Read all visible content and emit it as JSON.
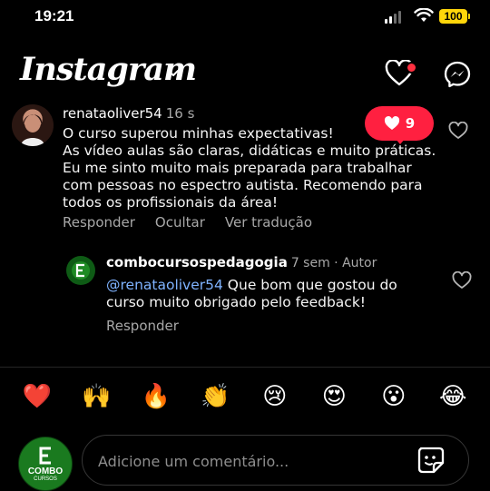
{
  "status_bar": {
    "time": "19:21",
    "battery": "100"
  },
  "header": {
    "title": "Instagram",
    "chevron_icon": "chevron-down-icon",
    "activity_icon": "heart-outline-icon",
    "messenger_icon": "messenger-icon"
  },
  "like_notification": {
    "count": "9",
    "icon": "heart-filled-icon",
    "color": "#ff2040"
  },
  "comment": {
    "username": "renataoliver54",
    "time": "16 s",
    "text": "O curso superou minhas expectativas!\nAs vídeo aulas são claras, didáticas e muito práticas. Eu me sinto muito mais preparada para trabalhar com pessoas no espectro autista. Recomendo para todos os profissionais da área!",
    "actions": [
      "Responder",
      "Ocultar",
      "Ver tradução"
    ]
  },
  "reply": {
    "username": "combocursospedagogia",
    "time": "7 sem",
    "author_tag": "Autor",
    "meta": "7 sem · Autor",
    "mention": "@renataoliver54",
    "text": " Que bom que gostou do curso muito obrigado pelo feedback!",
    "action": "Responder"
  },
  "emoji_reactions": [
    "❤️",
    "🙌",
    "🔥",
    "👏",
    "😢",
    "😍",
    "😮",
    "😂"
  ],
  "composer": {
    "placeholder": "Adicione um comentário...",
    "avatar_text_1": "COMBO",
    "avatar_text_2": "CURSOS",
    "sticker_icon": "sticker-icon"
  },
  "colors": {
    "background": "#000000",
    "accent_red": "#ff3040",
    "muted_text": "#a8a8a8",
    "mention_blue": "#7fb3ff"
  }
}
